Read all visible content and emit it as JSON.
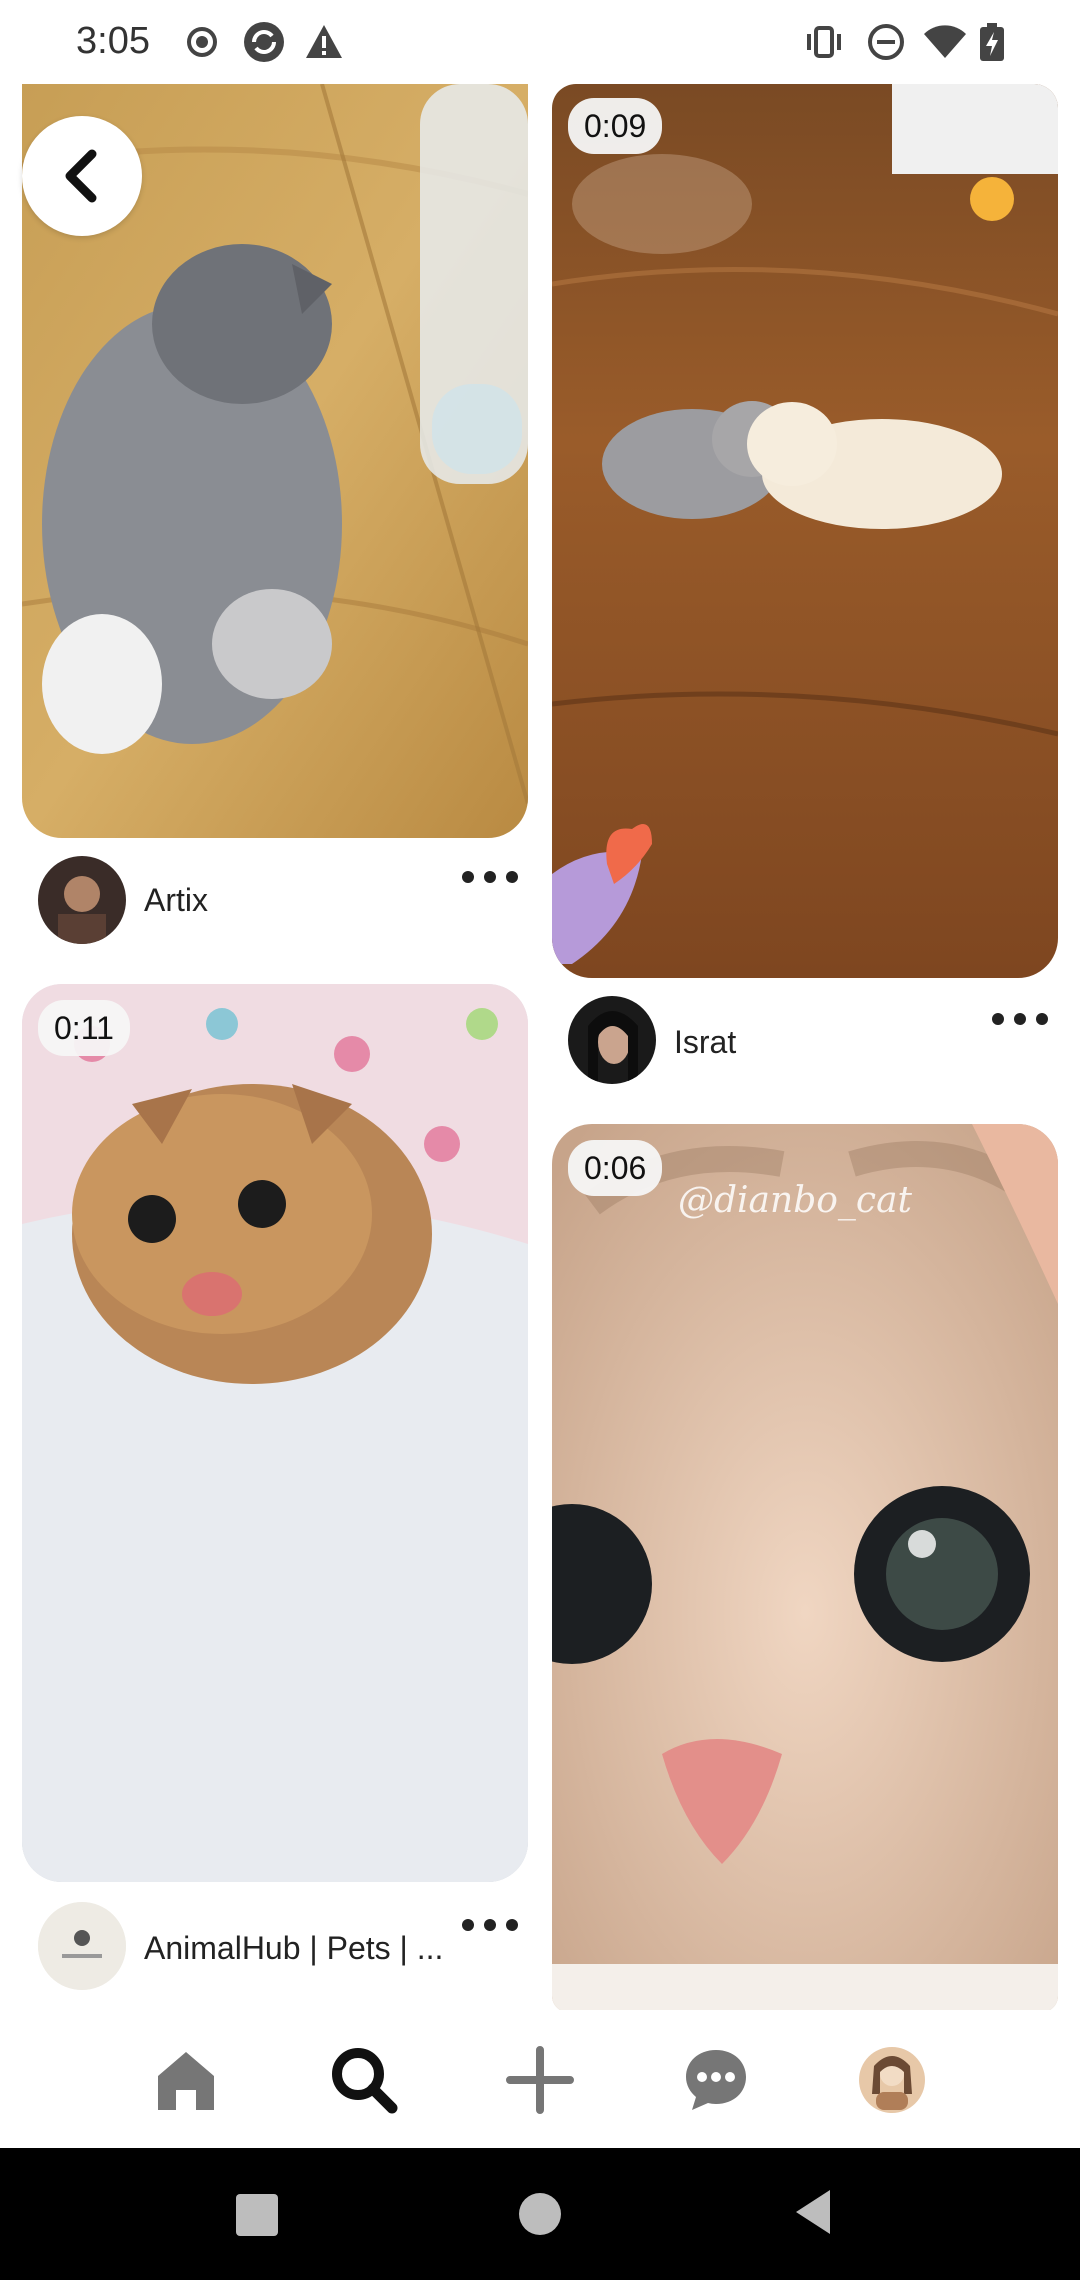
{
  "status_bar": {
    "time": "3:05",
    "left_icons": [
      "record-icon",
      "sync-icon",
      "warning-icon"
    ],
    "right_icons": [
      "vibrate-icon",
      "dnd-icon",
      "wifi-icon",
      "battery-icon"
    ]
  },
  "pins": [
    {
      "id": "pin-1",
      "author": "Artix",
      "duration": "",
      "image_desc": "grey-white kitten walking on wooden floor near water bottle"
    },
    {
      "id": "pin-2",
      "author": "Israt",
      "duration": "0:09",
      "image_desc": "two fluffy kittens on wooden floor"
    },
    {
      "id": "pin-3",
      "author": "AnimalHub | Pets | ...",
      "duration": "0:11",
      "image_desc": "tabby kitten with open mouth on white blanket"
    },
    {
      "id": "pin-4",
      "author": "",
      "duration": "0:06",
      "watermark": "@dianbo_cat",
      "image_desc": "close-up of cream tabby cat with big eyes"
    }
  ],
  "bottom_nav": {
    "items": [
      "home-icon",
      "search-icon",
      "create-icon",
      "messages-icon",
      "profile-avatar"
    ],
    "active": "search-icon"
  },
  "colors": {
    "accent_icon": "#111111",
    "inactive_icon": "#767676",
    "background": "#ffffff",
    "system_nav": "#000000"
  }
}
